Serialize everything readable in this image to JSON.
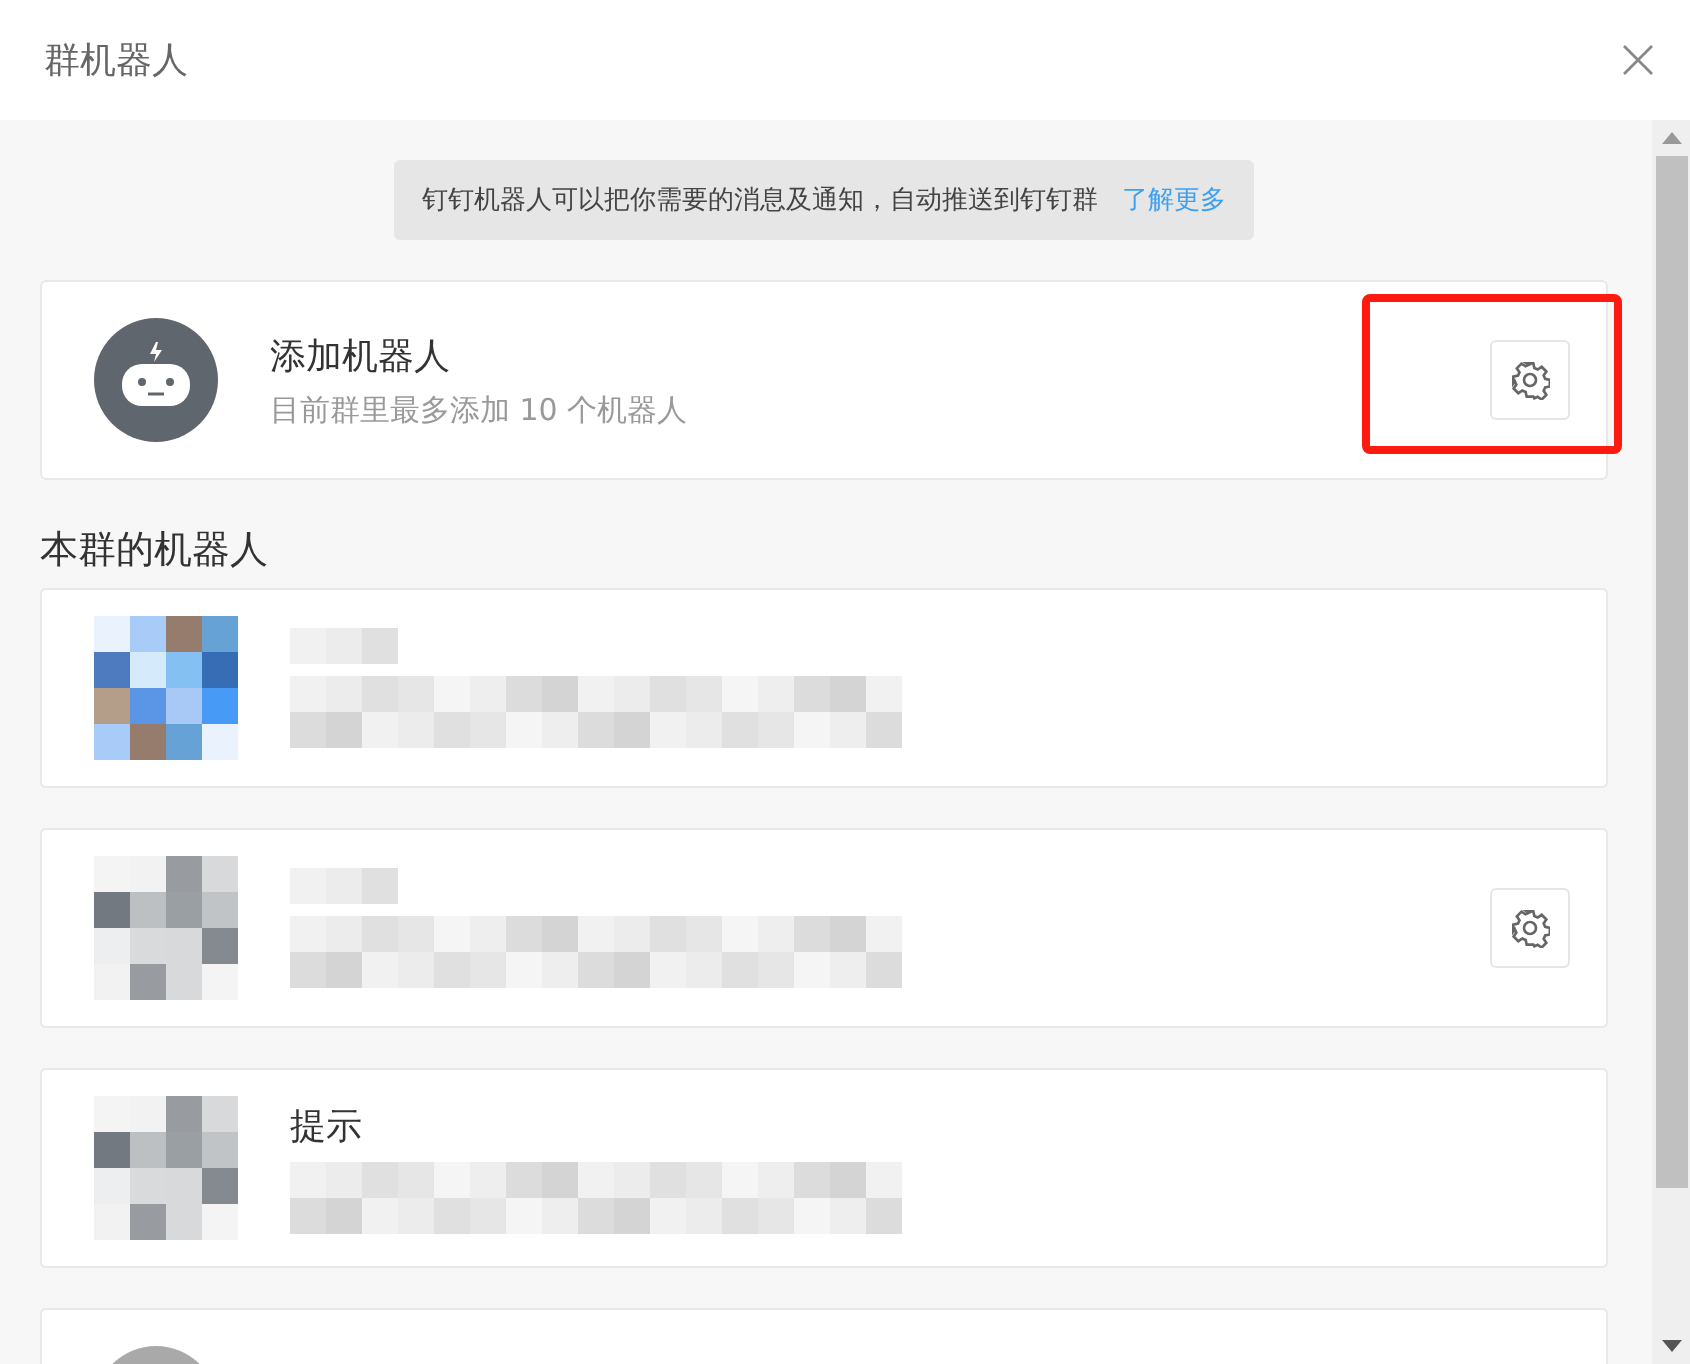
{
  "window": {
    "title": "群机器人"
  },
  "notice": {
    "text": "钉钉机器人可以把你需要的消息及通知，自动推送到钉钉群",
    "link": "了解更多"
  },
  "add_card": {
    "title": "添加机器人",
    "subtitle": "目前群里最多添加 10 个机器人",
    "highlighted": true
  },
  "section_title": "本群的机器人",
  "bots": [
    {
      "kind": "mosaic",
      "settings": false
    },
    {
      "kind": "mosaic",
      "settings": true
    },
    {
      "kind": "mosaic",
      "name": "提示",
      "settings": false
    },
    {
      "kind": "avatar"
    }
  ]
}
